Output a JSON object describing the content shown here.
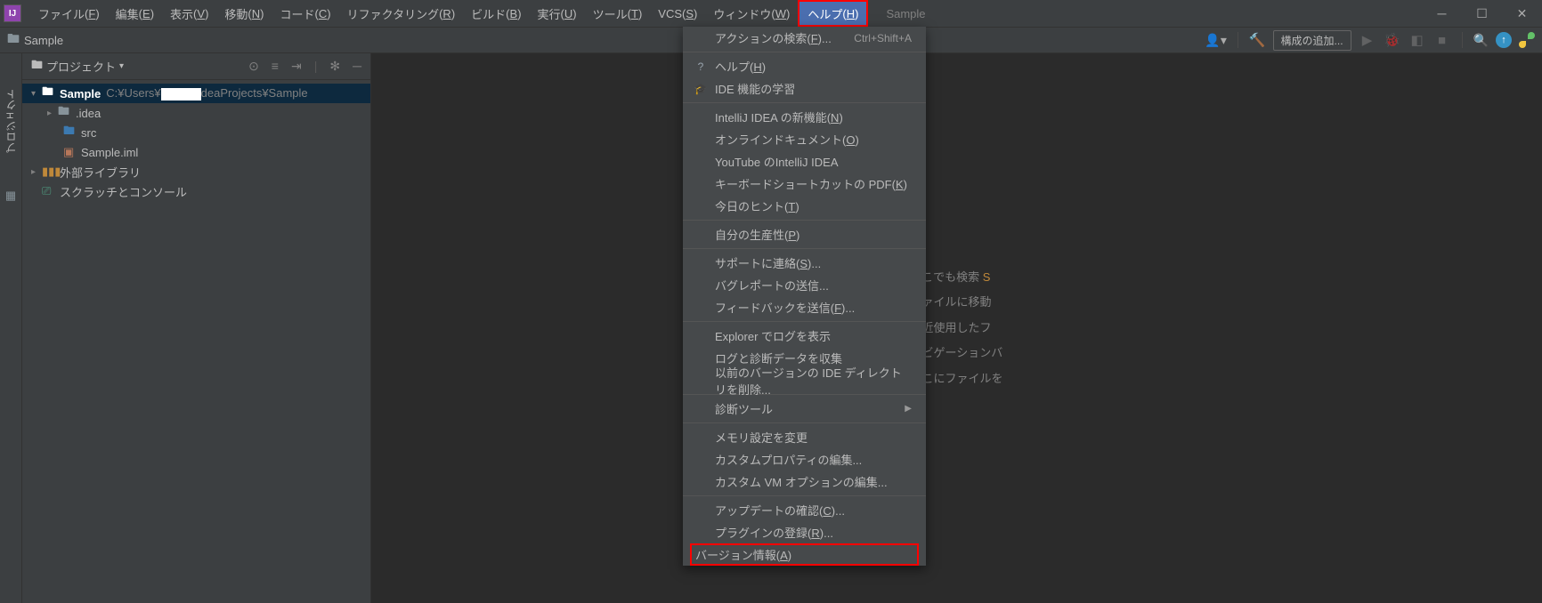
{
  "menubar": {
    "items": [
      {
        "label": "ファイル",
        "key": "F"
      },
      {
        "label": "編集",
        "key": "E"
      },
      {
        "label": "表示",
        "key": "V"
      },
      {
        "label": "移動",
        "key": "N"
      },
      {
        "label": "コード",
        "key": "C"
      },
      {
        "label": "リファクタリング",
        "key": "R"
      },
      {
        "label": "ビルド",
        "key": "B"
      },
      {
        "label": "実行",
        "key": "U"
      },
      {
        "label": "ツール",
        "key": "T"
      },
      {
        "label": "VCS",
        "key": "S"
      },
      {
        "label": "ウィンドウ",
        "key": "W"
      },
      {
        "label": "ヘルプ",
        "key": "H"
      }
    ],
    "project": "Sample"
  },
  "breadcrumb": {
    "project": "Sample"
  },
  "toolbar": {
    "config": "構成の追加..."
  },
  "gutter": {
    "project_label": "プロジェクト"
  },
  "panel": {
    "title": "プロジェクト",
    "tree": {
      "root": "Sample",
      "rootpath_pre": "C:¥Users¥",
      "rootpath_post": "deaProjects¥Sample",
      "idea": ".idea",
      "src": "src",
      "iml": "Sample.iml",
      "extlib": "外部ライブラリ",
      "scratch": "スクラッチとコンソール"
    }
  },
  "welcome": {
    "l1a": "どこでも検索 ",
    "l1b": "S",
    "l2": "ファイルに移動",
    "l3": "最近使用したフ",
    "l4": "ナビゲーションバ",
    "l5": "ここにファイルを"
  },
  "dropdown": {
    "items": [
      {
        "label": "アクションの検索",
        "key": "F",
        "shortcut": "Ctrl+Shift+A",
        "icon": ""
      },
      {
        "label": "ヘルプ",
        "key": "H",
        "icon": "?"
      },
      {
        "label": "IDE 機能の学習",
        "icon": "🎓"
      },
      {
        "label": "IntelliJ IDEA の新機能",
        "key": "N"
      },
      {
        "label": "オンラインドキュメント",
        "key": "O"
      },
      {
        "label": "YouTube のIntelliJ IDEA"
      },
      {
        "label": "キーボードショートカットの PDF",
        "key": "K"
      },
      {
        "label": "今日のヒント",
        "key": "T"
      },
      {
        "label": "自分の生産性",
        "key": "P"
      },
      {
        "label": "サポートに連絡",
        "key": "S",
        "suffix": "..."
      },
      {
        "label": "バグレポートの送信..."
      },
      {
        "label": "フィードバックを送信",
        "key": "F",
        "suffix": "..."
      },
      {
        "label": "Explorer でログを表示"
      },
      {
        "label": "ログと診断データを収集"
      },
      {
        "label": "以前のバージョンの IDE ディレクトリを削除..."
      },
      {
        "label": "診断ツール",
        "arrow": true
      },
      {
        "label": "メモリ設定を変更"
      },
      {
        "label": "カスタムプロパティの編集..."
      },
      {
        "label": "カスタム VM オプションの編集..."
      },
      {
        "label": "アップデートの確認",
        "key": "C",
        "suffix": "..."
      },
      {
        "label": "プラグインの登録",
        "key": "R",
        "suffix": "..."
      },
      {
        "label": "バージョン情報",
        "key": "A"
      }
    ]
  }
}
